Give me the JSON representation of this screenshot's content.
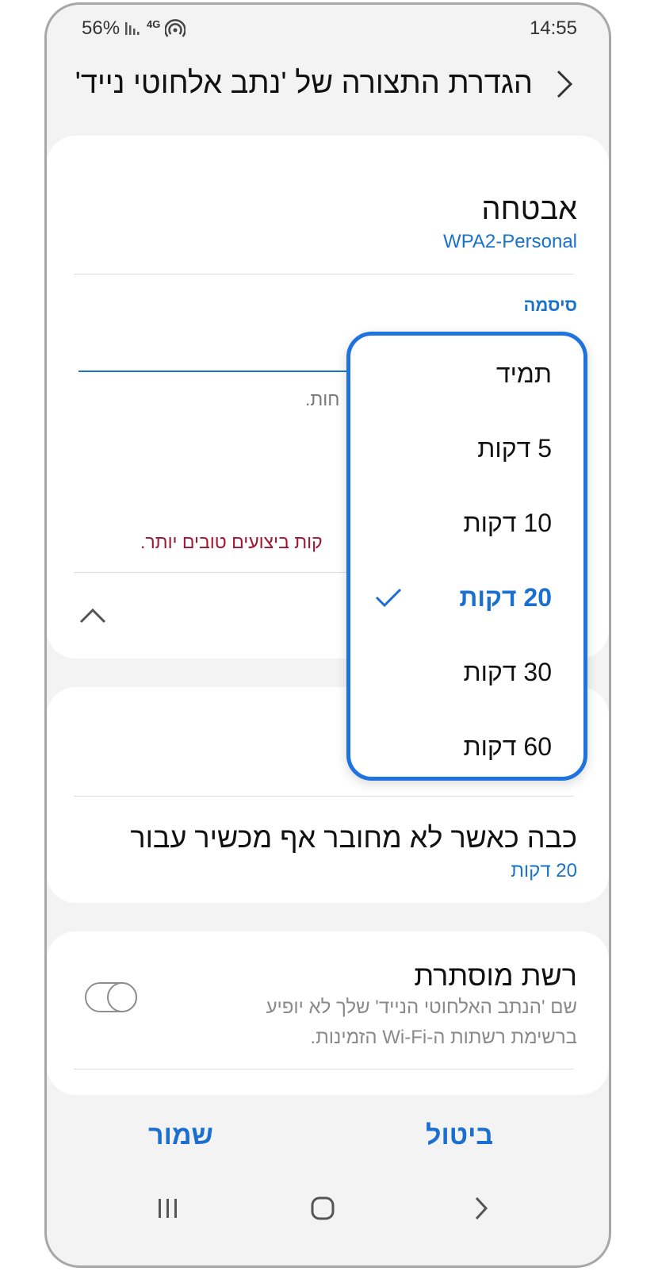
{
  "status_bar": {
    "battery": "56%",
    "network": "4G",
    "time": "14:55"
  },
  "header": {
    "title": "הגדרת התצורה של 'נתב אלחוטי נייד'",
    "back_icon": "chevron-right-icon"
  },
  "security": {
    "label": "אבטחה",
    "value": "WPA2-Personal"
  },
  "password": {
    "label": "סיסמה",
    "hint_partial": "חות.",
    "warning_partial": "קות ביצועים טובים יותר."
  },
  "timeout": {
    "label": "כבה כאשר לא מחובר אף מכשיר עבור",
    "value": "20 דקות"
  },
  "hidden_network": {
    "label": "רשת מוסתרת",
    "description_line1": "שם 'הנתב האלחוטי הנייד' שלך לא יופיע",
    "description_line2": "ברשימת רשתות ה-Wi-Fi הזמינות.",
    "enabled": false
  },
  "dropdown": {
    "options": [
      {
        "label": "תמיד"
      },
      {
        "label": "5 דקות"
      },
      {
        "label": "10 דקות"
      },
      {
        "label": "20 דקות",
        "selected": true
      },
      {
        "label": "30 דקות"
      },
      {
        "label": "60 דקות"
      }
    ],
    "check_icon": "checkmark-icon"
  },
  "actions": {
    "save_label": "שמור",
    "cancel_label": "ביטול"
  },
  "nav_bar": {
    "recent_icon": "recent-apps-icon",
    "home_icon": "home-icon",
    "back_icon": "back-icon"
  },
  "colors": {
    "accent": "#1a6fd1",
    "popup_border": "#1f73e0",
    "warning": "#a3152f",
    "background": "#f3f3f3"
  }
}
